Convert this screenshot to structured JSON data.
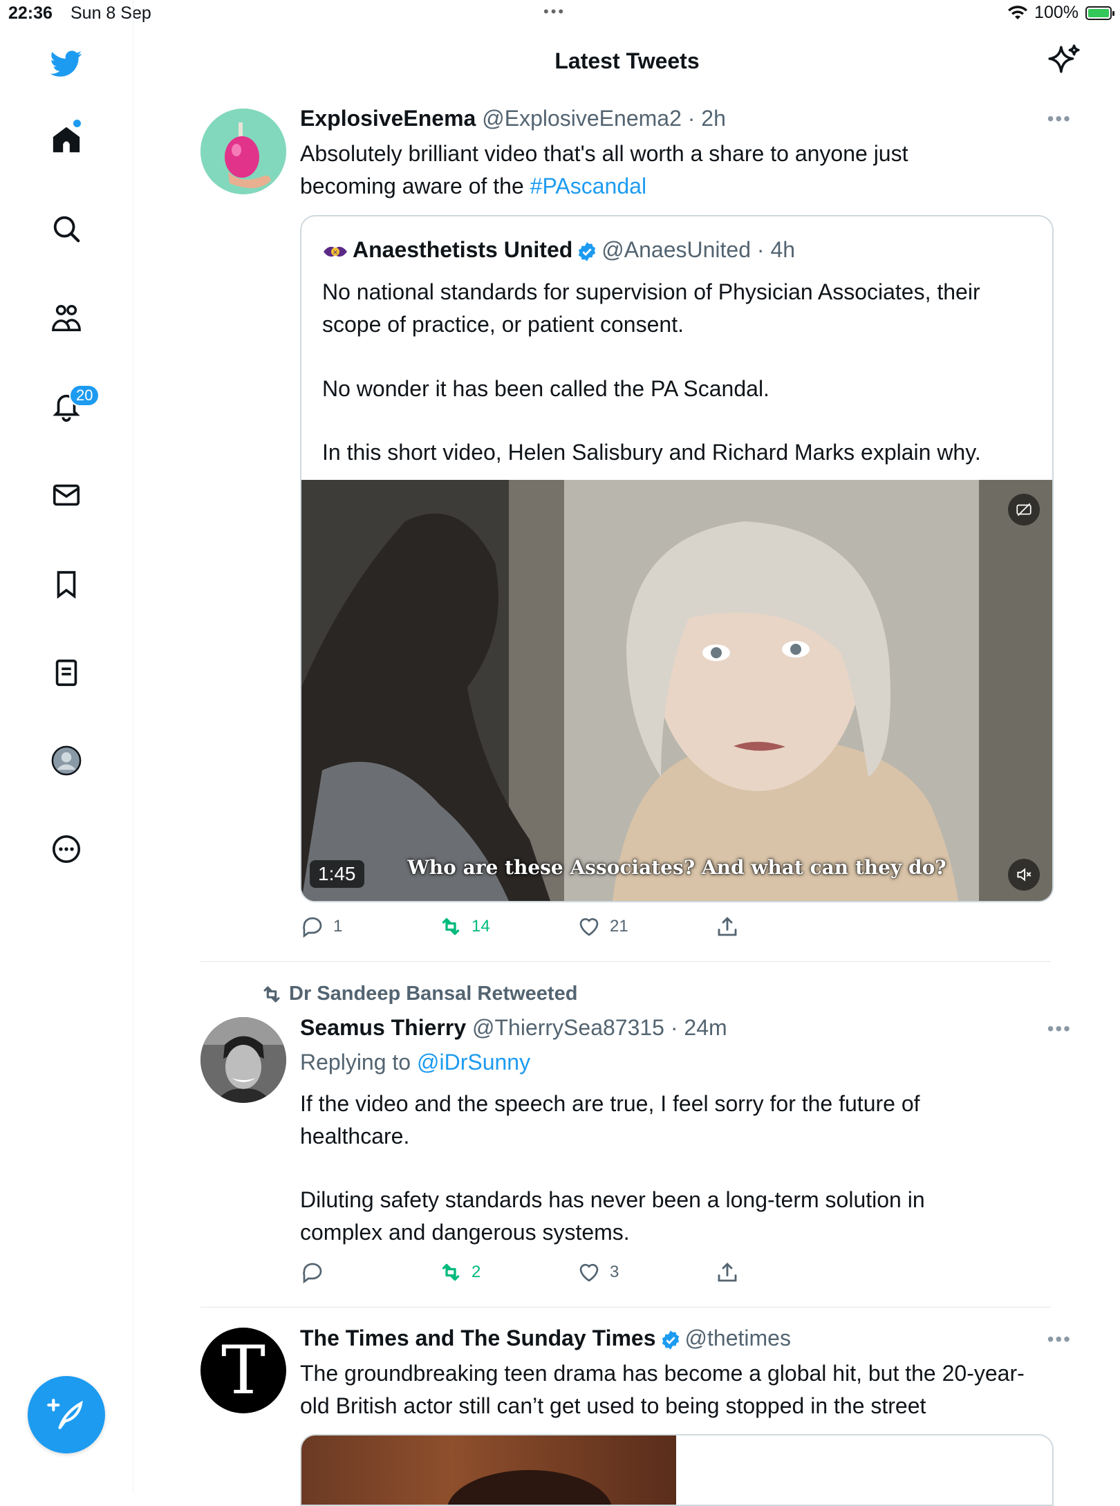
{
  "status_bar": {
    "time": "22:36",
    "date": "Sun 8 Sep",
    "battery": "100%",
    "more": "•••"
  },
  "header": {
    "title": "Latest Tweets"
  },
  "sidebar": {
    "items": [
      {
        "name": "home",
        "icon": "home-icon"
      },
      {
        "name": "search",
        "icon": "search-icon"
      },
      {
        "name": "communities",
        "icon": "people-icon"
      },
      {
        "name": "notifications",
        "icon": "bell-icon",
        "badge": "20"
      },
      {
        "name": "messages",
        "icon": "envelope-icon"
      },
      {
        "name": "bookmarks",
        "icon": "bookmark-icon"
      },
      {
        "name": "lists",
        "icon": "list-icon"
      },
      {
        "name": "profile",
        "icon": "avatar-icon"
      },
      {
        "name": "more",
        "icon": "ellipsis-circle-icon"
      }
    ],
    "brand_color": "#1d9bf0"
  },
  "tweets": [
    {
      "name": "ExplosiveEnema",
      "handle": "@ExplosiveEnema2",
      "time": "· 2h",
      "text_before": "Absolutely brilliant video that's all worth a share to anyone just becoming aware of the ",
      "hashtag": "#PAscandal",
      "quote": {
        "name": "Anaesthetists United",
        "handle": "@AnaesUnited",
        "time": "· 4h",
        "para1": "No national standards for supervision of Physician Associates, their scope of practice, or patient consent.",
        "para2": "No wonder it has been called the PA Scandal.",
        "para3": "In this short video, Helen Salisbury and Richard Marks explain why.",
        "video_duration": "1:45",
        "video_caption": "Who are these Associates? And what can they do?"
      },
      "replies": "1",
      "retweets": "14",
      "likes": "21"
    },
    {
      "retweeted_by": "Dr Sandeep Bansal Retweeted",
      "name": "Seamus Thierry",
      "handle": "@ThierrySea87315",
      "time": "· 24m",
      "replying_prefix": "Replying to ",
      "replying_to": "@iDrSunny",
      "para1": "If the video and the speech are true, I feel sorry for the future of healthcare.",
      "para2": "Diluting safety standards has never been a long-term solution in complex and dangerous systems.",
      "replies": "",
      "retweets": "2",
      "likes": "3"
    },
    {
      "name": "The Times and The Sunday Times",
      "handle": "@thetimes",
      "avatar_letter": "T",
      "text": "The groundbreaking teen drama has become a global hit, but the 20-year-old British actor still can’t get used to being stopped in the street"
    }
  ],
  "more_label": "•••"
}
